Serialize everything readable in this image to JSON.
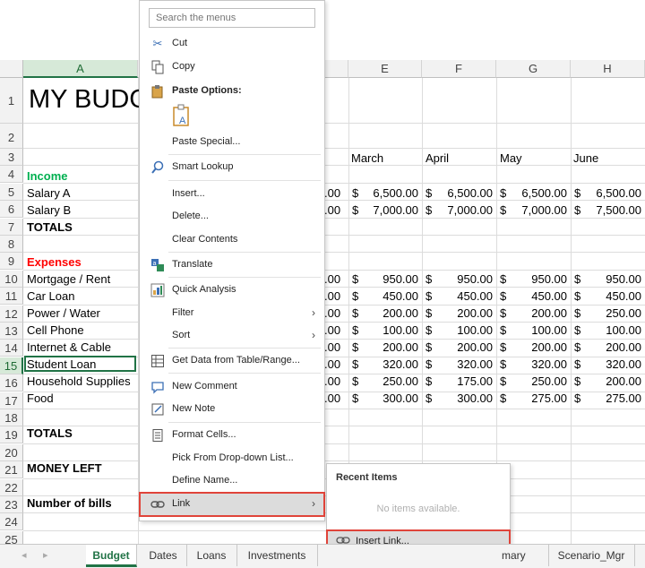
{
  "sheet": {
    "columns": [
      "A",
      "E",
      "F",
      "G",
      "H"
    ],
    "rows": [
      "1",
      "2",
      "3",
      "4",
      "5",
      "6",
      "7",
      "8",
      "9",
      "10",
      "11",
      "12",
      "13",
      "14",
      "15",
      "16",
      "17",
      "18",
      "19",
      "20",
      "21",
      "22",
      "23",
      "24",
      "25"
    ],
    "title": "MY BUDG",
    "months": [
      "March",
      "April",
      "May",
      "June"
    ],
    "labels": {
      "income": "Income",
      "salary_a": "Salary A",
      "salary_b": "Salary B",
      "totals1": "TOTALS",
      "expenses": "Expenses",
      "mortgage": "Mortgage / Rent",
      "car_loan": "Car Loan",
      "power_water": "Power / Water",
      "cell_phone": "Cell Phone",
      "internet": "Internet & Cable",
      "student_loan": "Student Loan",
      "household": "Household Supplies",
      "food": "Food",
      "totals2": "TOTALS",
      "money_left": "MONEY LEFT",
      "num_bills": "Number of bills"
    },
    "partial_d": ".00",
    "currency": "$",
    "values": {
      "salary_a": [
        "6,500.00",
        "6,500.00",
        "6,500.00",
        "6,500.00"
      ],
      "salary_b": [
        "7,000.00",
        "7,000.00",
        "7,000.00",
        "7,500.00"
      ],
      "mortgage": [
        "950.00",
        "950.00",
        "950.00",
        "950.00"
      ],
      "car_loan": [
        "450.00",
        "450.00",
        "450.00",
        "450.00"
      ],
      "power_water": [
        "200.00",
        "200.00",
        "200.00",
        "250.00"
      ],
      "cell_phone": [
        "100.00",
        "100.00",
        "100.00",
        "100.00"
      ],
      "internet": [
        "200.00",
        "200.00",
        "200.00",
        "200.00"
      ],
      "student_loan": [
        "320.00",
        "320.00",
        "320.00",
        "320.00"
      ],
      "household": [
        "250.00",
        "175.00",
        "250.00",
        "200.00"
      ],
      "food": [
        "300.00",
        "300.00",
        "275.00",
        "275.00"
      ]
    },
    "colors": {
      "income": "#00b050",
      "expenses": "#ff0000",
      "accent": "#217346"
    }
  },
  "tabs": [
    "Budget",
    "Dates",
    "Loans",
    "Investments",
    "mary",
    "Scenario_Mgr"
  ],
  "context_menu": {
    "search_placeholder": "Search the menus",
    "items": {
      "cut": "Cut",
      "copy": "Copy",
      "paste_options": "Paste Options:",
      "paste_special": "Paste Special...",
      "smart_lookup": "Smart Lookup",
      "insert": "Insert...",
      "delete": "Delete...",
      "clear_contents": "Clear Contents",
      "translate": "Translate",
      "quick_analysis": "Quick Analysis",
      "filter": "Filter",
      "sort": "Sort",
      "get_data": "Get Data from Table/Range...",
      "new_comment": "New Comment",
      "new_note": "New Note",
      "format_cells": "Format Cells...",
      "pick_dropdown": "Pick From Drop-down List...",
      "define_name": "Define Name...",
      "link": "Link"
    }
  },
  "link_submenu": {
    "title": "Recent Items",
    "empty": "No items available.",
    "insert_link": "Insert Link..."
  }
}
